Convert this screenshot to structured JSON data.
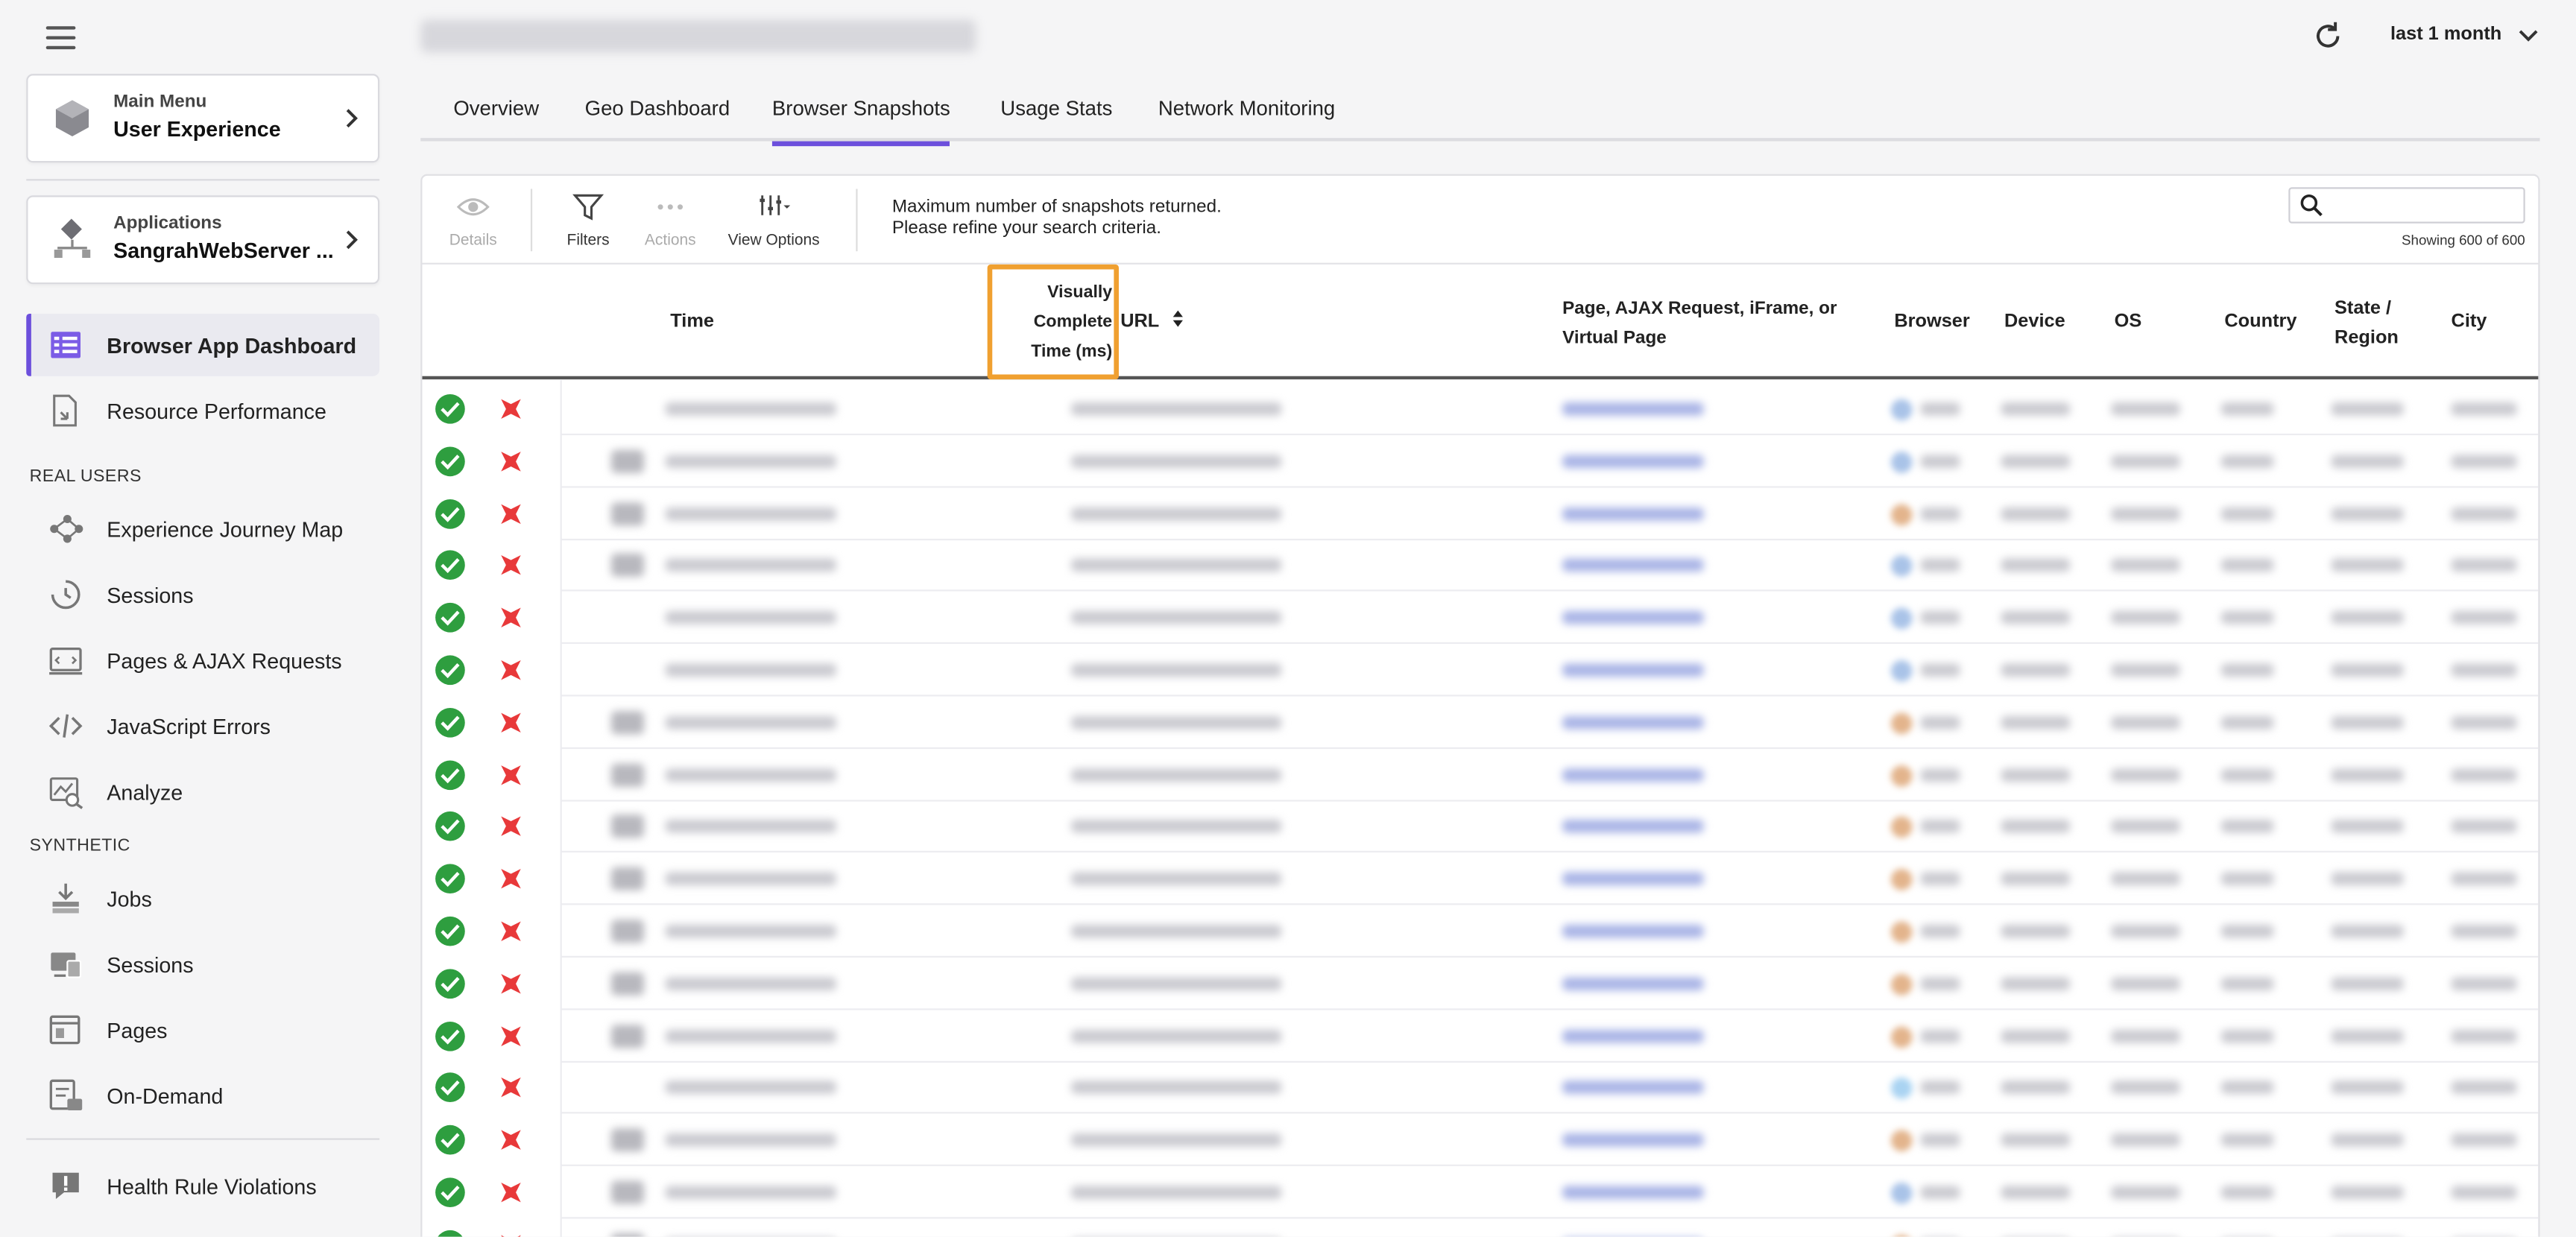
{
  "sidebar": {
    "main_menu": {
      "small": "Main Menu",
      "big": "User Experience"
    },
    "applications": {
      "small": "Applications",
      "big": "SangrahWebServer ..."
    },
    "items_top": [
      {
        "label": "Browser App Dashboard",
        "icon": "dashboard-icon",
        "active": true
      },
      {
        "label": "Resource Performance",
        "icon": "resource-icon",
        "active": false
      }
    ],
    "section_real_users": "REAL USERS",
    "items_real_users": [
      {
        "label": "Experience Journey Map",
        "icon": "journey-map-icon"
      },
      {
        "label": "Sessions",
        "icon": "sessions-icon"
      },
      {
        "label": "Pages & AJAX Requests",
        "icon": "pages-ajax-icon"
      },
      {
        "label": "JavaScript Errors",
        "icon": "code-icon"
      },
      {
        "label": "Analyze",
        "icon": "analyze-icon"
      }
    ],
    "section_synthetic": "SYNTHETIC",
    "items_synthetic": [
      {
        "label": "Jobs",
        "icon": "jobs-icon"
      },
      {
        "label": "Sessions",
        "icon": "synthetic-sessions-icon"
      },
      {
        "label": "Pages",
        "icon": "pages-icon"
      },
      {
        "label": "On-Demand",
        "icon": "on-demand-icon"
      }
    ],
    "items_bottom": [
      {
        "label": "Health Rule Violations",
        "icon": "health-rule-icon"
      }
    ]
  },
  "header": {
    "time_range": "last 1 month"
  },
  "tabs": [
    {
      "label": "Overview",
      "active": false
    },
    {
      "label": "Geo Dashboard",
      "active": false
    },
    {
      "label": "Browser Snapshots",
      "active": true
    },
    {
      "label": "Usage Stats",
      "active": false
    },
    {
      "label": "Network Monitoring",
      "active": false
    }
  ],
  "toolbar": {
    "details": "Details",
    "filters": "Filters",
    "actions": "Actions",
    "view_options": "View Options",
    "message_line1": "Maximum number of snapshots returned.",
    "message_line2": "Please refine your search criteria.",
    "search_placeholder": "",
    "showing": "Showing 600 of 600"
  },
  "table": {
    "columns": {
      "time": "Time",
      "visually_complete_l1": "Visually",
      "visually_complete_l2": "Complete",
      "visually_complete_l3": "Time (ms)",
      "url": "URL",
      "page_l1": "Page, AJAX Request, iFrame, or",
      "page_l2": "Virtual Page",
      "browser": "Browser",
      "device": "Device",
      "os": "OS",
      "country": "Country",
      "state_l1": "State /",
      "state_l2": "Region",
      "city": "City"
    },
    "row_count_visible": 17,
    "colors": {
      "ok": "#2e9e3f",
      "fail": "#e8393a",
      "accent": "#6c4fdc",
      "highlight": "#f0a030"
    }
  }
}
